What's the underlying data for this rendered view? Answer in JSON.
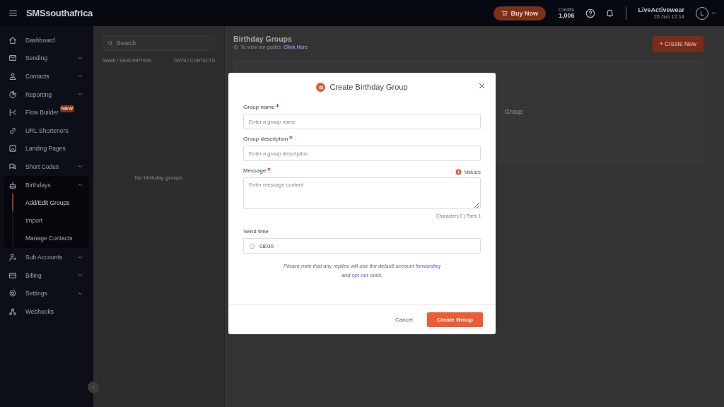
{
  "header": {
    "logo": "SMSsouthafrica",
    "buy_button": "Buy Now",
    "credits_label": "Credits",
    "credits_value": "1,006",
    "account_name": "LiveActivewear",
    "account_time": "20 Jun 12:14",
    "avatar_letter": "L"
  },
  "sidebar": {
    "items": [
      {
        "label": "Dashboard",
        "expandable": false
      },
      {
        "label": "Sending",
        "expandable": true,
        "expanded": false
      },
      {
        "label": "Contacts",
        "expandable": true,
        "expanded": false
      },
      {
        "label": "Reporting",
        "expandable": true,
        "expanded": false
      },
      {
        "label": "Flow Builder",
        "expandable": false,
        "badge": "NEW"
      },
      {
        "label": "URL Shorteners",
        "expandable": false
      },
      {
        "label": "Landing Pages",
        "expandable": false
      },
      {
        "label": "Short Codes",
        "expandable": true,
        "expanded": false
      },
      {
        "label": "Birthdays",
        "expandable": true,
        "expanded": true,
        "children": [
          {
            "label": "Add/Edit Groups",
            "selected": true
          },
          {
            "label": "Import",
            "selected": false
          },
          {
            "label": "Manage Contacts",
            "selected": false
          }
        ]
      },
      {
        "label": "Sub Accounts",
        "expandable": true,
        "expanded": false
      },
      {
        "label": "Billing",
        "expandable": true,
        "expanded": false
      },
      {
        "label": "Settings",
        "expandable": true,
        "expanded": false
      },
      {
        "label": "Webhooks",
        "expandable": false
      }
    ]
  },
  "list_panel": {
    "search": {
      "placeholder": "Search"
    },
    "columns": [
      "NAME / DESCRIPTION",
      "DAYS / CONTACTS"
    ],
    "empty_text": "No birthday groups"
  },
  "page": {
    "title": "Birthday Groups",
    "guide_text": "To view our guides",
    "guide_link": "Click Here",
    "create_button": "+ Create New",
    "card_text": "Group"
  },
  "dialog": {
    "title": "Create Birthday Group",
    "fields": [
      {
        "kind": "input",
        "label": "Group name",
        "required": true,
        "placeholder": "Enter a group name"
      },
      {
        "kind": "input",
        "label": "Group description",
        "required": true,
        "placeholder": "Enter a group description"
      },
      {
        "kind": "textarea",
        "label": "Message",
        "required": true,
        "placeholder": "Enter message content",
        "values_link": "Values",
        "counter": "Characters 0 | Parts 1"
      },
      {
        "kind": "time",
        "label": "Send time",
        "required": false,
        "value": "08:00"
      }
    ],
    "note": [
      {
        "kind": "text",
        "text": "Please note that any replies will use the default account "
      },
      {
        "kind": "link",
        "text": "forwarding"
      },
      {
        "kind": "break"
      },
      {
        "kind": "text",
        "text": "and "
      },
      {
        "kind": "link",
        "text": "opt-out"
      },
      {
        "kind": "text",
        "text": " rules."
      }
    ],
    "cancel_button": "Cancel",
    "submit_button": "Create Group"
  }
}
